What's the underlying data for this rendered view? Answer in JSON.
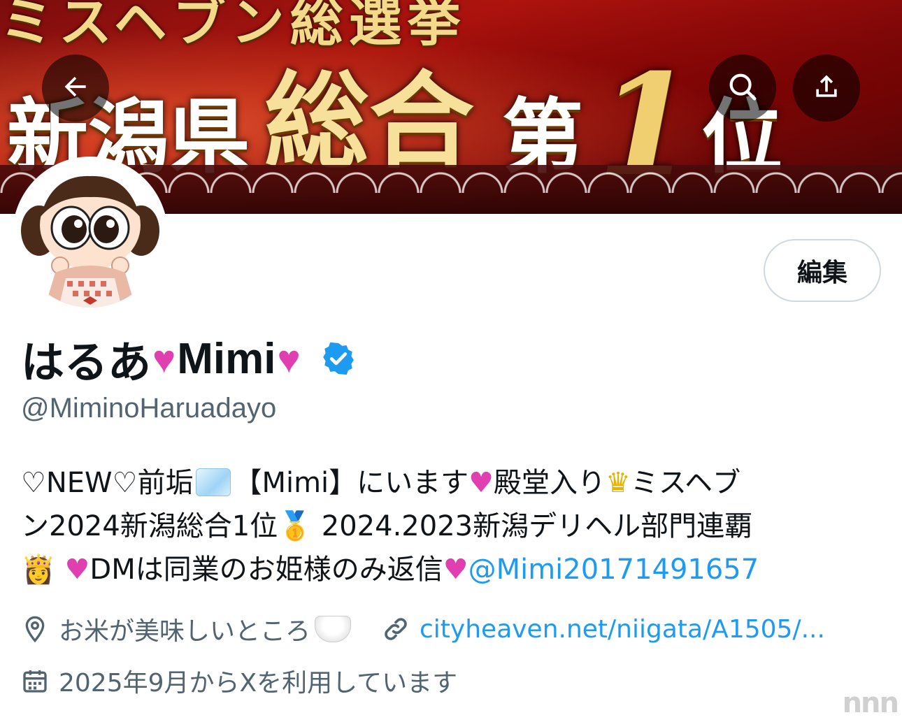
{
  "banner": {
    "top_text": "ミスヘブン総選挙",
    "main_1": "新潟県",
    "main_2": "総合",
    "main_3": "第",
    "main_4": "1",
    "main_5": "位"
  },
  "header": {
    "back_icon": "arrow-left-icon",
    "search_icon": "search-icon",
    "share_icon": "share-icon"
  },
  "profile": {
    "edit_label": "編集",
    "name_part1": "はるあ",
    "name_heart1": "♥",
    "name_part2": "Mimi",
    "name_heart2": "♥",
    "handle": "@MiminoHaruadayo",
    "verified": true
  },
  "bio": {
    "line1_a": "♡NEW♡前垢",
    "line1_b": "【Mimi】にいます",
    "line1_heart": "♥",
    "line1_c": "殿堂入り",
    "line1_crown": "♛",
    "line1_d": "ミスヘブ",
    "line2_a": "ン2024新潟総合1位",
    "line2_medal": "🥇",
    "line2_b": "2024.2023新潟デリヘル部門連覇",
    "line3_princess": "👸",
    "line3_heart": "♥",
    "line3_a": "DMは同業のお姫様のみ返信",
    "line3_heart2": "♥",
    "line3_mention": "@Mimi20171491657"
  },
  "meta": {
    "location": "お米が美味しいところ",
    "website": "cityheaven.net/niigata/A1505/...",
    "joined": "2025年9月からXを利用しています"
  },
  "watermark": "nnn",
  "colors": {
    "accent": "#1d9bf0",
    "heart": "#e03fb0",
    "secondary_text": "#536471"
  }
}
